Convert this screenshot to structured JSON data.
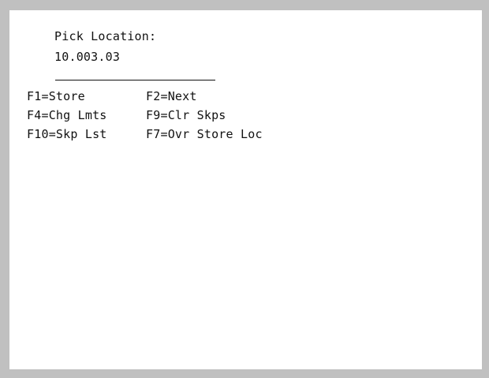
{
  "screen": {
    "prompt_label": "Pick Location:",
    "location_value": "10.003.03",
    "input_value": ""
  },
  "function_keys": {
    "f1": "F1=Store",
    "f2": "F2=Next",
    "f4": "F4=Chg Lmts",
    "f9": "F9=Clr Skps",
    "f10": "F10=Skp Lst",
    "f7": "F7=Ovr Store Loc"
  }
}
